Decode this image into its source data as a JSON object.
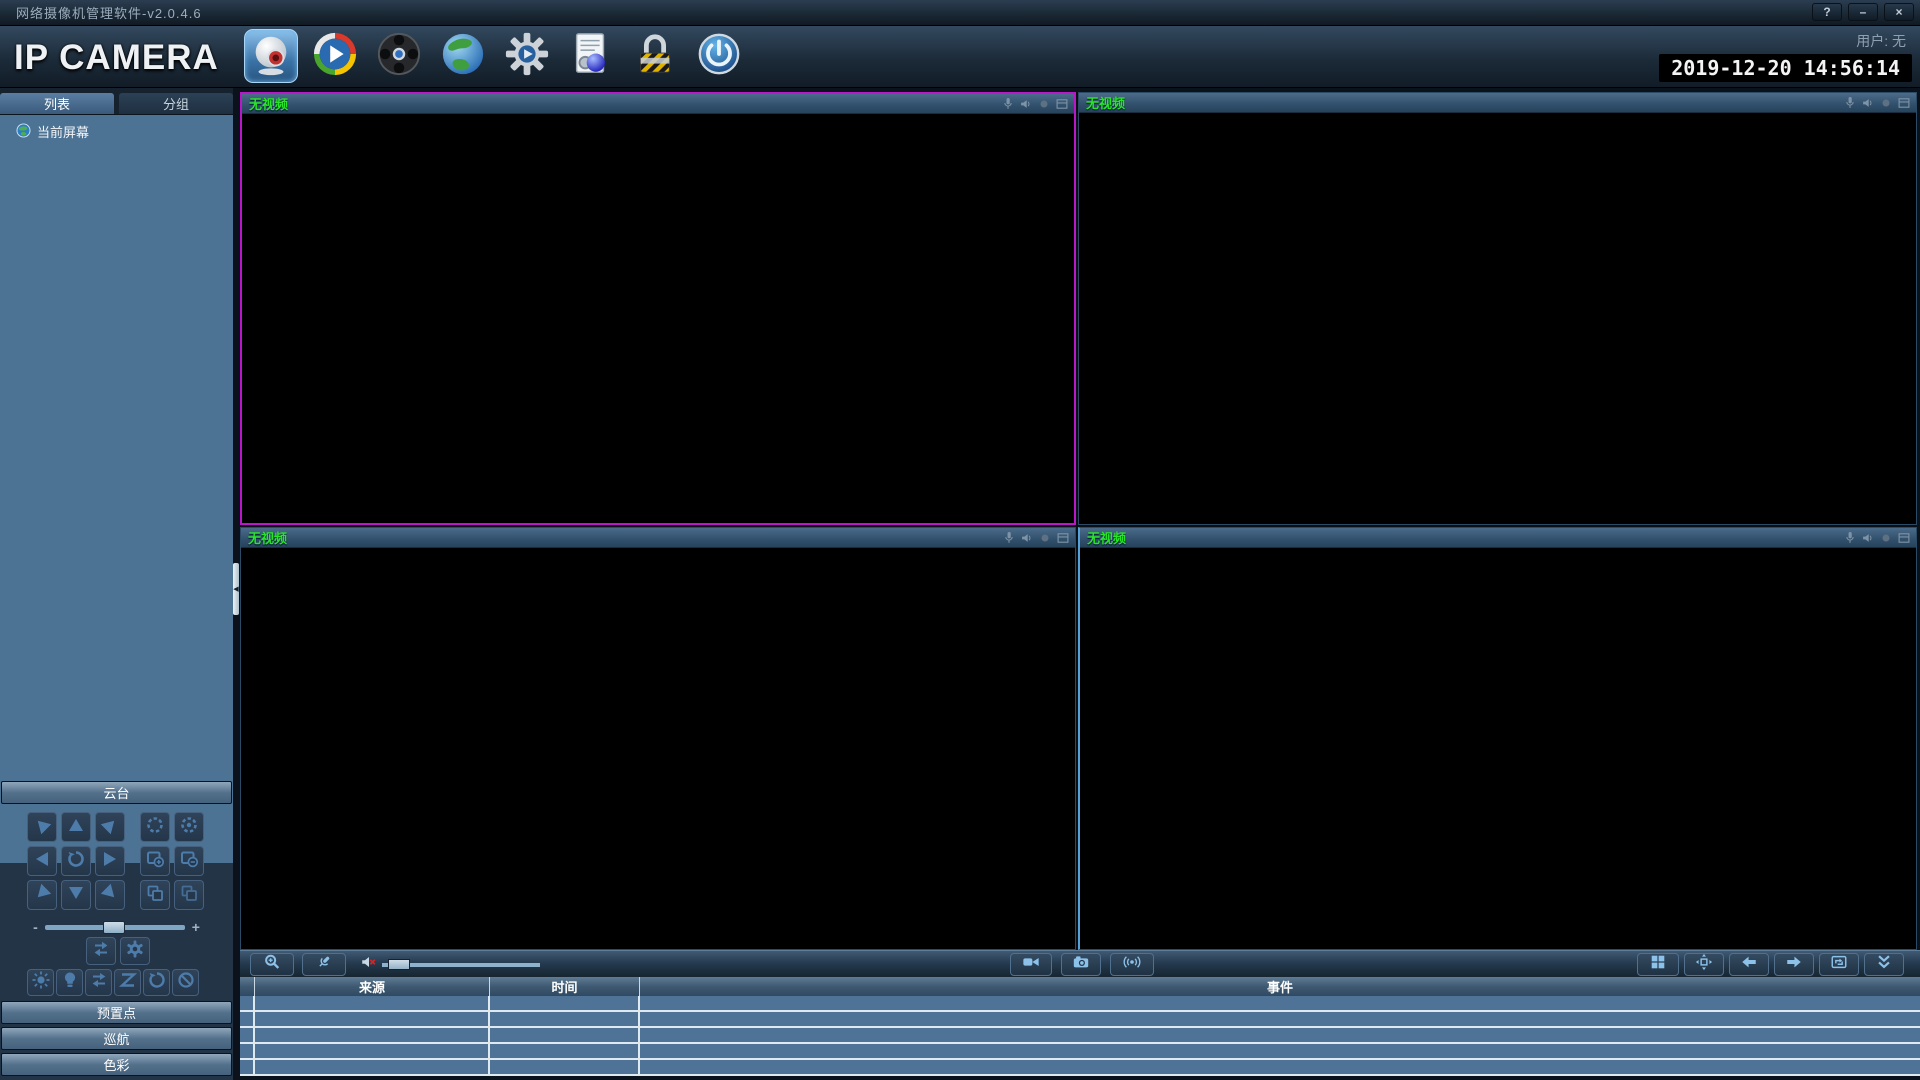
{
  "window": {
    "title": "网络摄像机管理软件-v2.0.4.6",
    "help": "?",
    "minimize": "–",
    "close": "×"
  },
  "header": {
    "logo": "IP CAMERA",
    "user_label": "用户: 无",
    "datetime": "2019-12-20 14:56:14",
    "toolbar": [
      {
        "id": "preview",
        "icon": "webcam-icon",
        "active": true
      },
      {
        "id": "playback",
        "icon": "media-player-icon",
        "active": false
      },
      {
        "id": "records",
        "icon": "film-reel-icon",
        "active": false
      },
      {
        "id": "network",
        "icon": "globe-icon",
        "active": false
      },
      {
        "id": "settings",
        "icon": "gear-icon",
        "active": false
      },
      {
        "id": "log",
        "icon": "log-icon",
        "active": false
      },
      {
        "id": "lock",
        "icon": "lock-icon",
        "active": false
      },
      {
        "id": "power",
        "icon": "power-icon",
        "active": false
      }
    ]
  },
  "sidebar": {
    "tabs": [
      {
        "label": "列表",
        "active": true
      },
      {
        "label": "分组",
        "active": false
      }
    ],
    "tree": [
      {
        "label": "当前屏幕",
        "icon": "screen-globe-icon"
      }
    ],
    "ptz": {
      "title": "云台",
      "slider_minus": "-",
      "slider_plus": "+"
    },
    "sections": [
      {
        "label": "预置点"
      },
      {
        "label": "巡航"
      },
      {
        "label": "色彩"
      }
    ]
  },
  "video_grid": {
    "panels": [
      {
        "label": "无视频",
        "selected": true
      },
      {
        "label": "无视频",
        "selected": false
      },
      {
        "label": "无视频",
        "selected": false
      },
      {
        "label": "无视频",
        "selected": false
      }
    ]
  },
  "event_table": {
    "columns": [
      "来源",
      "时间",
      "事件"
    ],
    "rows": [],
    "row_count": 5
  },
  "colors": {
    "selected_panel_border": "#b818c8",
    "panel_divider_blue": "#55a2d8",
    "no_video_green": "#2ae42a",
    "table_row_blue": "#4e7396",
    "sidebar_tree_blue": "#4c7294"
  }
}
